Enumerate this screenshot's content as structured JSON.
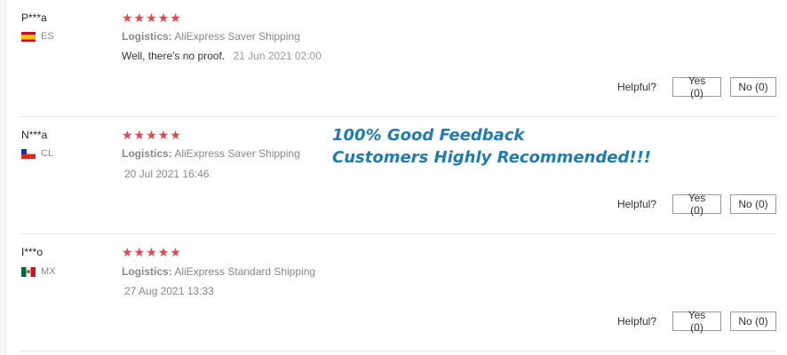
{
  "colors": {
    "star": "#e5434f",
    "promo": "#1f7bb0"
  },
  "promo": {
    "line1": "100% Good Feedback",
    "line2": "Customers Highly Recommended!!!"
  },
  "reviews": [
    {
      "user": "P***a",
      "country_code": "ES",
      "stars": "★★★★★",
      "rating": 5,
      "logistics_label": "Logistics:",
      "logistics_value": "AliExpress Saver Shipping",
      "text": "Well, there's no proof.",
      "date": "21 Jun 2021 02:00",
      "helpful_label": "Helpful?",
      "yes_label": "Yes (0)",
      "no_label": "No (0)"
    },
    {
      "user": "N***a",
      "country_code": "CL",
      "stars": "★★★★★",
      "rating": 5,
      "logistics_label": "Logistics:",
      "logistics_value": "AliExpress Saver Shipping",
      "date": "20 Jul 2021 16:46",
      "helpful_label": "Helpful?",
      "yes_label": "Yes (0)",
      "no_label": "No (0)"
    },
    {
      "user": "I***o",
      "country_code": "MX",
      "stars": "★★★★★",
      "rating": 4.8,
      "logistics_label": "Logistics:",
      "logistics_value": "AliExpress Standard Shipping",
      "date": "27 Aug 2021 13:33",
      "helpful_label": "Helpful?",
      "yes_label": "Yes (0)",
      "no_label": "No (0)"
    }
  ]
}
